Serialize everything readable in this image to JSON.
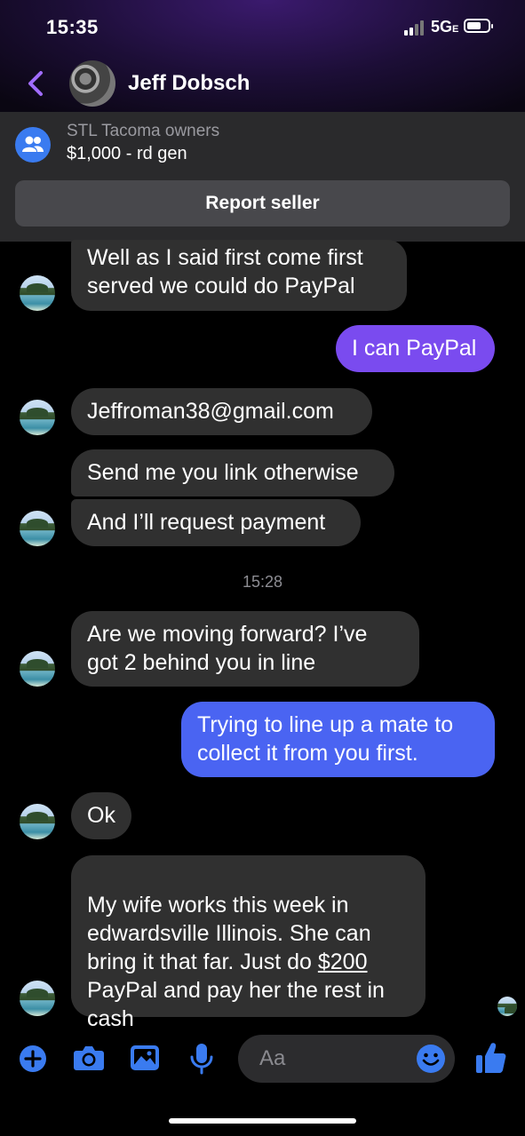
{
  "status_bar": {
    "time": "15:35",
    "network": "5G",
    "network_suffix": "E"
  },
  "header": {
    "contact_name": "Jeff Dobsch"
  },
  "listing": {
    "group": "STL Tacoma owners",
    "title": "$1,000 - rd gen",
    "report_label": "Report seller"
  },
  "messages": {
    "m1": "Well as I said first come first\nserved we could do PayPal",
    "m2": "I can PayPal",
    "m3": "Jeffroman38@gmail.com",
    "m4": "Send me you link otherwise",
    "m5": "And I’ll request payment",
    "timestamp": "15:28",
    "m6": "Are we moving forward?   I’ve\ngot 2 behind you in line",
    "m7": "Trying to line up a mate to\ncollect it from you first.",
    "m8": "Ok",
    "m9_part1": "My wife works this week in\nedwardsville Illinois.  She can\nbring it that far.  Just do ",
    "m9_link": "$200",
    "m9_part2": "\nPayPal and pay her the rest in\ncash"
  },
  "composer": {
    "placeholder": "Aa"
  },
  "colors": {
    "accent": "#a06cff",
    "outgoing_purple": "#7a4bef",
    "outgoing_blue": "#4a64f2",
    "incoming": "#303030",
    "icon_blue": "#3a7bf0"
  }
}
